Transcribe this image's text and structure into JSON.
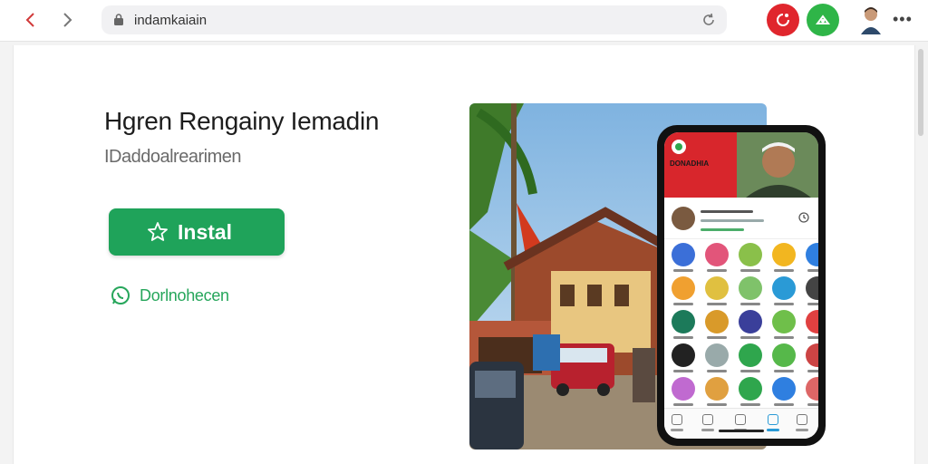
{
  "browser": {
    "url": "indamkaiain",
    "back_icon": "chevron-left-icon",
    "forward_icon": "chevron-right-icon",
    "reload_icon": "reload-icon",
    "more_label": "•••",
    "extensions": [
      {
        "name": "red-extension-icon",
        "color": "#e0262d"
      },
      {
        "name": "green-extension-icon",
        "color": "#2fb548"
      }
    ]
  },
  "hero": {
    "title": "Hgren Rengainy Iemadin",
    "subtitle": "IDaddoalrearimen",
    "install_label": "Instal",
    "whatsapp_label": "Dorlnohecen"
  },
  "colors": {
    "accent_green": "#1fa35a",
    "brand_red": "#d8262c"
  },
  "phone": {
    "banner_text": "DONADHIA",
    "tabs": 5
  }
}
